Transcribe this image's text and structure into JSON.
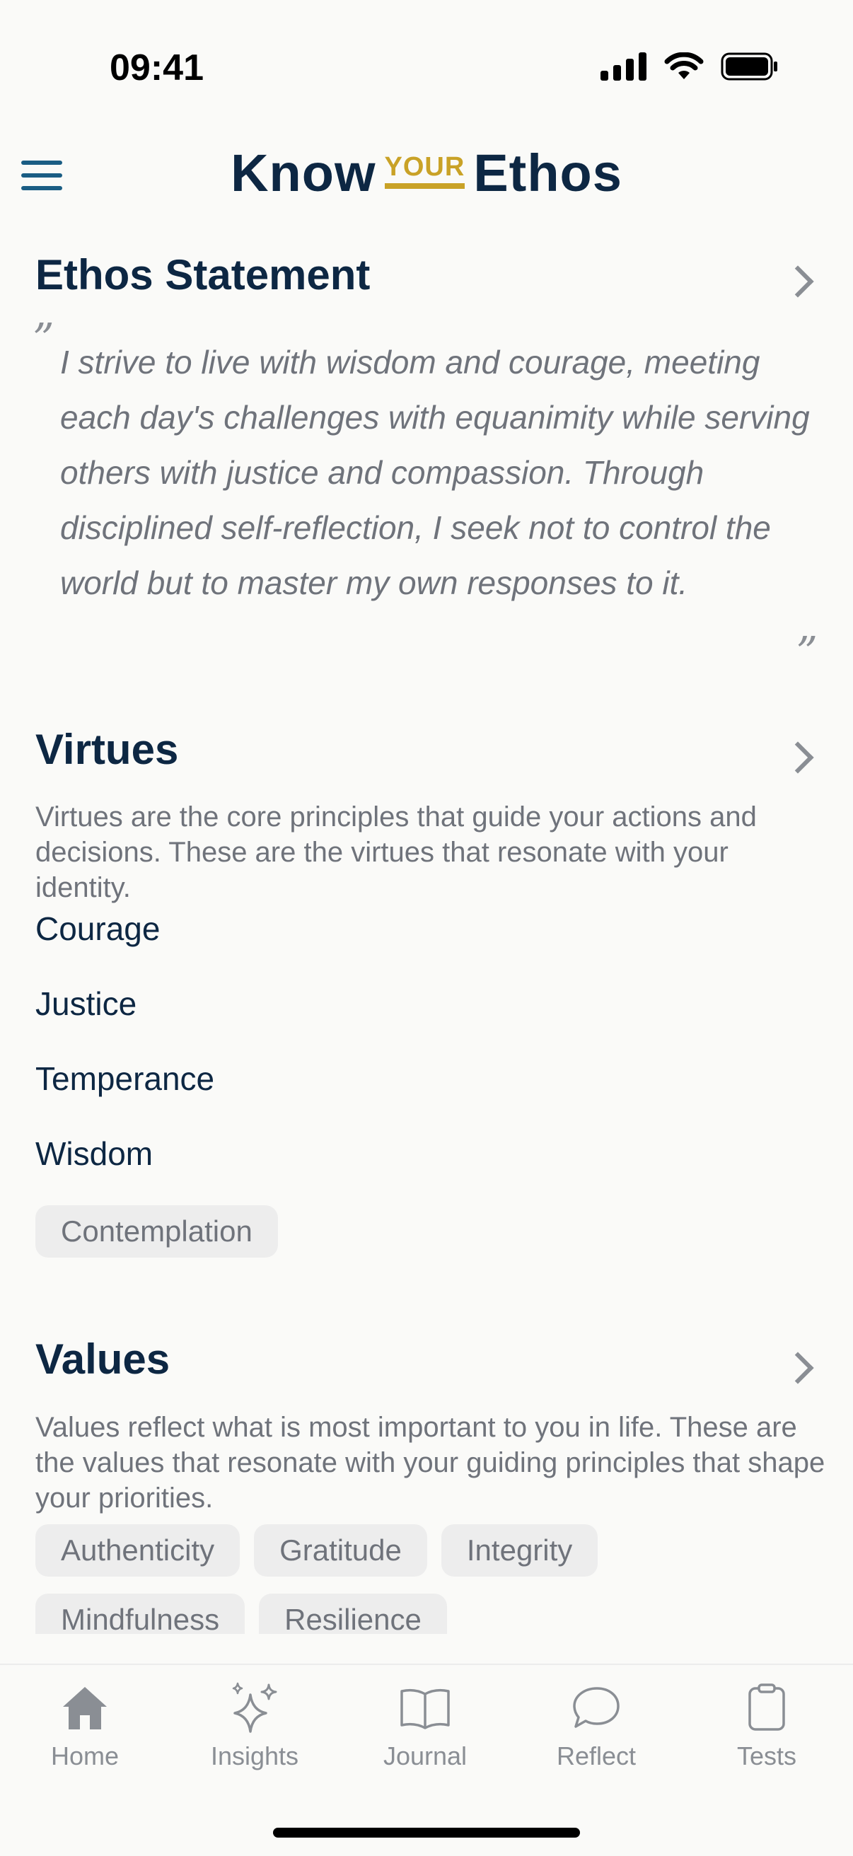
{
  "status_bar": {
    "time": "09:41"
  },
  "header": {
    "brand_left": "Know",
    "brand_mid": "YOUR",
    "brand_right": "Ethos"
  },
  "ethos": {
    "title": "Ethos Statement",
    "text": "I strive to live with wisdom and courage, meeting each day's challenges with equanimity while serving others with justice and compassion. Through disciplined self-reflection, I seek not to control the world but to master my own responses to it."
  },
  "virtues": {
    "title": "Virtues",
    "description": "Virtues are the core principles that guide your actions and decisions. These are the virtues that resonate with your identity.",
    "items": [
      "Courage",
      "Justice",
      "Temperance",
      "Wisdom"
    ],
    "tags": [
      "Contemplation"
    ]
  },
  "values": {
    "title": "Values",
    "description": "Values reflect what is most important to you in life. These are the values that resonate with your guiding principles that shape your priorities.",
    "chips": [
      "Authenticity",
      "Gratitude",
      "Integrity",
      "Mindfulness",
      "Resilience"
    ]
  },
  "tabs": [
    {
      "label": "Home",
      "icon": "home-icon"
    },
    {
      "label": "Insights",
      "icon": "sparkles-icon"
    },
    {
      "label": "Journal",
      "icon": "book-icon"
    },
    {
      "label": "Reflect",
      "icon": "chat-bubble-icon"
    },
    {
      "label": "Tests",
      "icon": "clipboard-icon"
    }
  ]
}
